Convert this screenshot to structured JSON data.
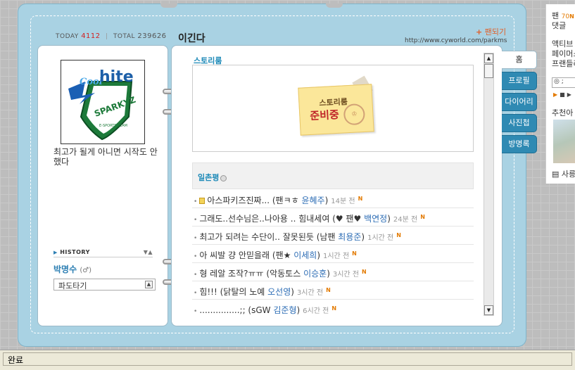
{
  "header": {
    "today_label": "TODAY",
    "today_count": "4112",
    "total_label": "TOTAL",
    "total_count": "239626",
    "mini_title": "이긴다",
    "fan_link": "팬되기",
    "url": "http://www.cyworld.com/parkms"
  },
  "profile": {
    "logo_text_top": "hite",
    "logo_text_cool": "Cool",
    "logo_text_main": "SPARKYZ",
    "logo_text_sub": "E-SPORTS TEAM",
    "intro": "최고가 될게 아니면 시작도 안했다",
    "history_label": "HISTORY",
    "owner_name": "박명수",
    "owner_gender": "(♂)",
    "dropdown_value": "파도타기"
  },
  "story": {
    "title": "스토리룸",
    "note_line1": "스토리룸",
    "note_line2": "준비중"
  },
  "comments_section": {
    "title": "일촌평",
    "items": [
      {
        "text": "아스파키즈진짜... (팬ㅋㅎ ",
        "author": "윤혜주",
        "suffix": ")",
        "time": "14분 전",
        "new": "N"
      },
      {
        "text": "그래도..선수님은..나아용 .. 힘내세여 (♥ 팬♥ ",
        "author": "백연정",
        "suffix": ")",
        "time": "24분 전",
        "new": "N"
      },
      {
        "text": "최고가 되려는 수단이.. 잘못된듯 (남팬 ",
        "author": "최용준",
        "suffix": ")",
        "time": "1시간 전",
        "new": "N"
      },
      {
        "text": "아 씨발 걍 안믿을래 (팬★ ",
        "author": "이세희",
        "suffix": ")",
        "time": "1시간 전",
        "new": "N"
      },
      {
        "text": "형 레알 조작?ㅠㅠ (악동토스 ",
        "author": "이승훈",
        "suffix": ")",
        "time": "3시간 전",
        "new": "N"
      },
      {
        "text": "힘!!! (닭탈의 노예 ",
        "author": "오선영",
        "suffix": ")",
        "time": "3시간 전",
        "new": "N"
      },
      {
        "text": "...............;; (sGW ",
        "author": "김준형",
        "suffix": ")",
        "time": "6시간 전",
        "new": "N"
      }
    ]
  },
  "tabs": [
    "홈",
    "프로필",
    "다이어리",
    "사진첩",
    "방명록"
  ],
  "sidebar": {
    "line1_label": "팬",
    "line1_count": "70",
    "line1_new": "N",
    "line2": "댓글",
    "line3": "액티브",
    "line4": "페이머스",
    "line5": "프랜들리",
    "input_value": ";",
    "recommend": "추천아",
    "footer": "사릉"
  },
  "status": {
    "text": "완료"
  }
}
